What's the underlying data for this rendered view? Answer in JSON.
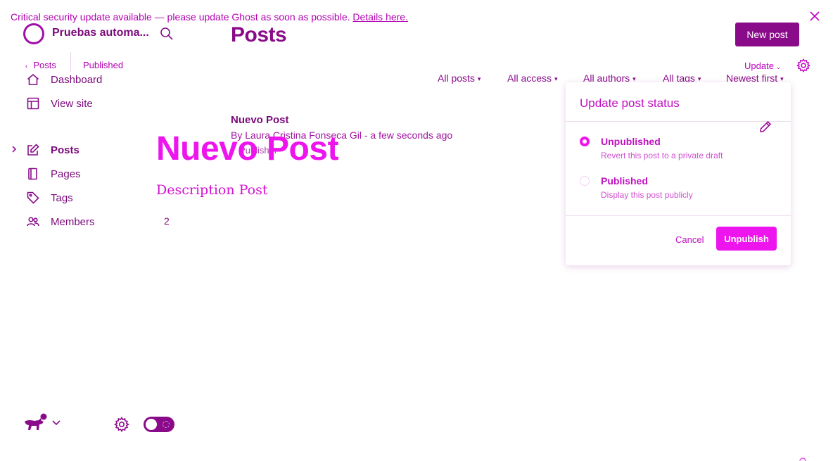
{
  "banner": {
    "text": "Critical security update available — please update Ghost as soon as possible.",
    "link": "Details here."
  },
  "sidebar": {
    "site_title": "Pruebas automa...",
    "breadcrumb": [
      "Posts",
      "Published"
    ],
    "items": [
      {
        "label": "Dashboard",
        "icon": "home-icon"
      },
      {
        "label": "View site",
        "icon": "layout-icon"
      },
      {
        "label": "Posts",
        "icon": "edit-icon",
        "active": true
      },
      {
        "label": "Pages",
        "icon": "pages-icon"
      },
      {
        "label": "Tags",
        "icon": "tag-icon"
      },
      {
        "label": "Members",
        "icon": "members-icon"
      }
    ]
  },
  "header": {
    "title": "Posts",
    "new_post": "New post",
    "update": "Update"
  },
  "filters": [
    "All posts",
    "All access",
    "All authors",
    "All tags",
    "Newest first"
  ],
  "post": {
    "title": "Nuevo Post",
    "meta": "By Laura Cristina Fonseca Gil - a few seconds ago",
    "status": "Publisher"
  },
  "preview": {
    "title": "Nuevo Post",
    "description": "Description Post",
    "number": "2"
  },
  "popup": {
    "title": "Update post status",
    "options": [
      {
        "label": "Unpublished",
        "description": "Revert this post to a private draft",
        "selected": true
      },
      {
        "label": "Published",
        "description": "Display this post publicly",
        "selected": false
      }
    ],
    "cancel": "Cancel",
    "confirm": "Unpublish"
  },
  "colors": {
    "brand": "#8a0b8a",
    "accent": "#ee14ee"
  }
}
